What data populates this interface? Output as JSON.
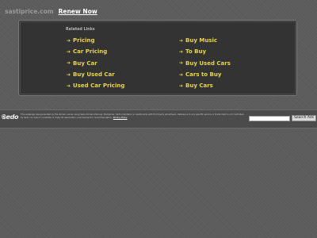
{
  "header": {
    "domain": "sastiprice.com",
    "renew_label": "Renew Now"
  },
  "related": {
    "title": "Related Links",
    "left_links": [
      "Pricing",
      "Car Pricing",
      "Buy Car",
      "Buy Used Car",
      "Used Car Pricing"
    ],
    "right_links": [
      "Buy Music",
      "To Buy",
      "Buy Used Cars",
      "Cars to Buy",
      "Buy Cars"
    ],
    "arrow_icon": "arrow-right-icon"
  },
  "footer": {
    "logo": "sedo",
    "disclaimer_pre": "This webpage was generated by the domain owner using Sedo Domain Parking. Disclaimer: Sedo maintains no relationship with third party advertisers. Reference to any specific service or trade mark is not controlled by Sedo nor does it constitute or imply its association, endorsement or recommendation.",
    "privacy_link": "Privacy Policy",
    "search_value": "",
    "search_button_label": "Search Ads"
  },
  "colors": {
    "link": "#e8d44d",
    "background": "#5b5b5b",
    "panel": "#333333"
  }
}
